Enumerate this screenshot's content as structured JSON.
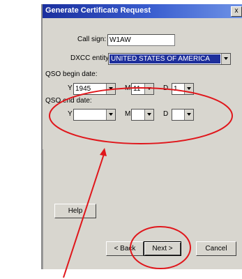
{
  "window": {
    "title": "Generate Certificate Request",
    "close_label": "x"
  },
  "form": {
    "call_sign_label": "Call sign:",
    "call_sign_value": "W1AW",
    "dxcc_label": "DXCC entity:",
    "dxcc_value": "UNITED STATES OF AMERICA",
    "qso_begin_label": "QSO begin date:",
    "qso_end_label": "QSO end date:",
    "year_label": "Y",
    "month_label": "M",
    "day_label": "D",
    "begin_year": "1945",
    "begin_month": "11",
    "begin_day": "1",
    "end_year": "",
    "end_month": "",
    "end_day": ""
  },
  "buttons": {
    "help": "Help",
    "back": "< Back",
    "next": "Next >",
    "cancel": "Cancel"
  },
  "annotation_color": "#e0161b"
}
